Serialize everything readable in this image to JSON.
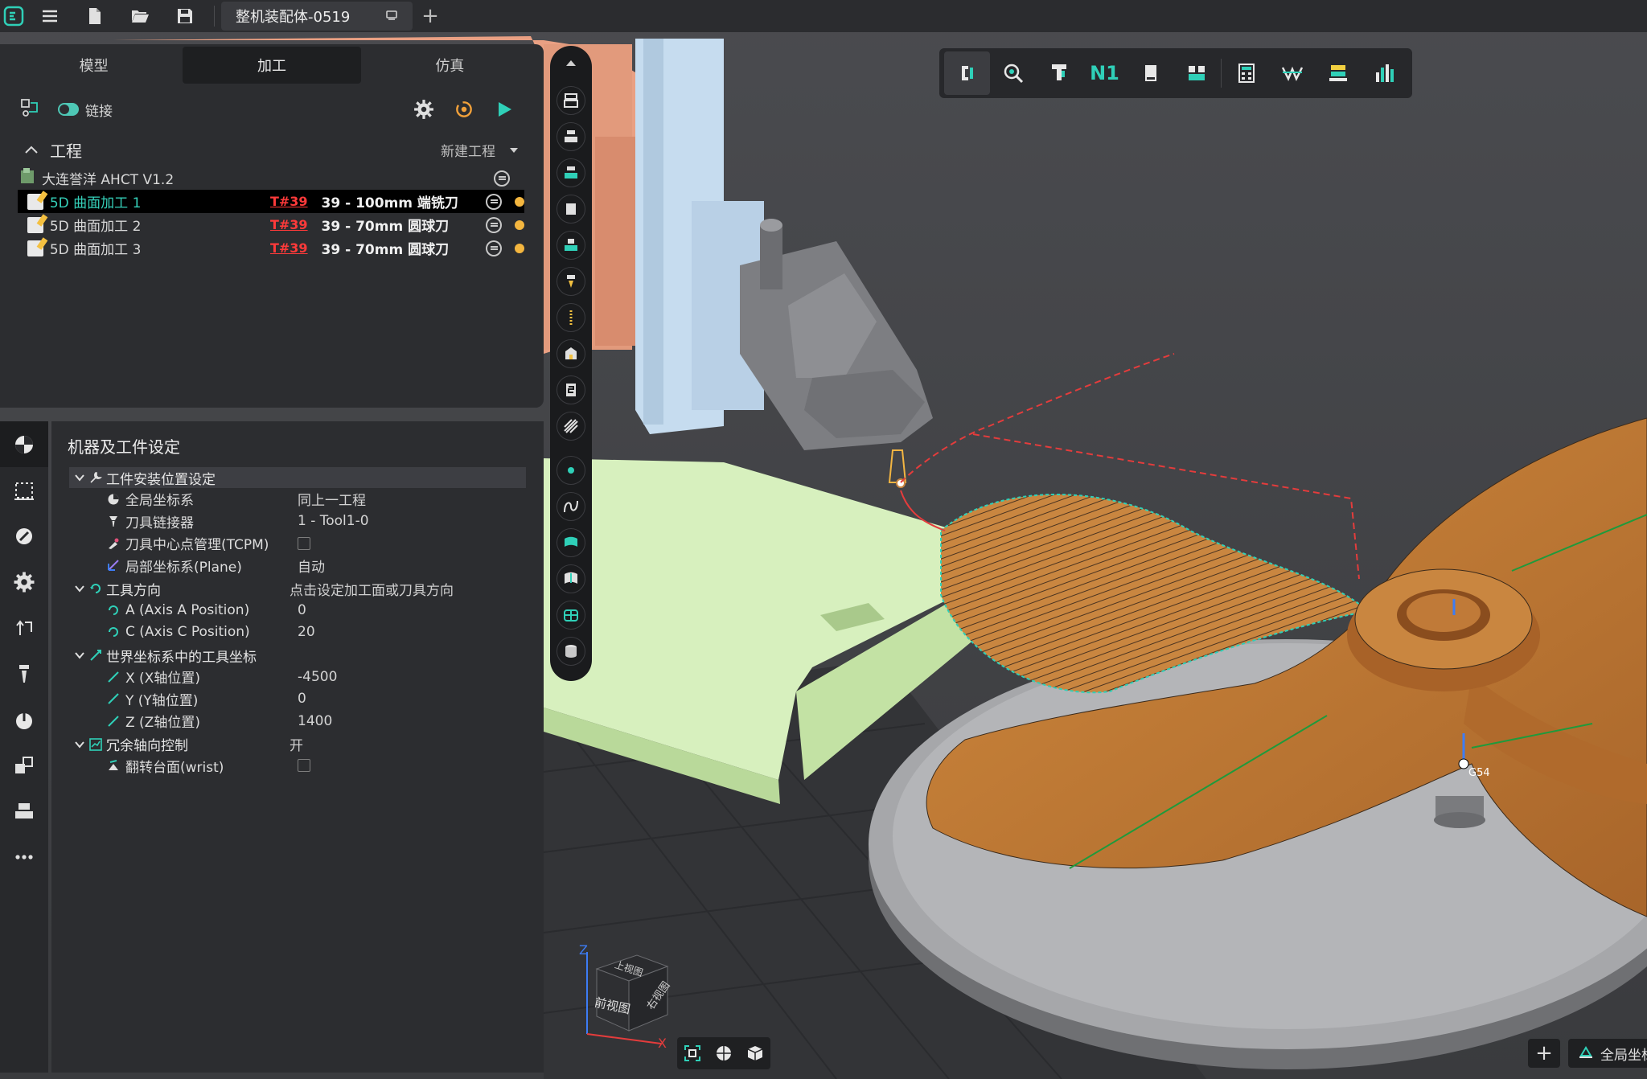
{
  "titlebar": {
    "document_tab": "整机装配体-0519",
    "add_tab": "+"
  },
  "panel_tabs": [
    "模型",
    "加工",
    "仿真"
  ],
  "active_tab": "加工",
  "link": {
    "label": "链接",
    "enabled": true
  },
  "project": {
    "title": "工程",
    "new_project": "新建工程",
    "machine": "大连誉洋 AHCT V1.2",
    "operations": [
      {
        "name": "5D 曲面加工 1",
        "tool_number": "T#39",
        "tool_desc": "39 - 100mm 端铣刀",
        "selected": true
      },
      {
        "name": "5D 曲面加工 2",
        "tool_number": "T#39",
        "tool_desc": "39 - 70mm 圆球刀",
        "selected": false
      },
      {
        "name": "5D 曲面加工 3",
        "tool_number": "T#39",
        "tool_desc": "39 - 70mm 圆球刀",
        "selected": false
      }
    ]
  },
  "settings": {
    "title": "机器及工件设定",
    "groups": [
      {
        "label": "工件安装位置设定",
        "icon": "wrench-icon",
        "rows": [
          {
            "name": "全局坐标系",
            "value": "同上一工程",
            "icon": "globe-icon"
          },
          {
            "name": "刀具链接器",
            "value": "1 - Tool1-0",
            "icon": "tool-holder-icon"
          },
          {
            "name": "刀具中心点管理(TCPM)",
            "value": "",
            "checkbox": true,
            "icon": "tcpm-icon"
          },
          {
            "name": "局部坐标系(Plane)",
            "value": "自动",
            "icon": "plane-axis-icon"
          }
        ]
      },
      {
        "label": "工具方向",
        "icon": "rotate-icon",
        "rows": [
          {
            "name": "A (Axis A Position)",
            "value": "0",
            "icon": "rotate-icon"
          },
          {
            "name": "C (Axis C Position)",
            "value": "20",
            "icon": "rotate-icon"
          }
        ],
        "value": "点击设定加工面或刀具方向"
      },
      {
        "label": "世界坐标系中的工具坐标",
        "icon": "axis-icon",
        "rows": [
          {
            "name": "X (X轴位置)",
            "value": "-4500",
            "icon": "axis-icon"
          },
          {
            "name": "Y (Y轴位置)",
            "value": "0",
            "icon": "axis-icon"
          },
          {
            "name": "Z (Z轴位置)",
            "value": "1400",
            "icon": "axis-icon"
          }
        ]
      },
      {
        "label": "冗余轴向控制",
        "icon": "chart-icon",
        "value": "开",
        "rows": [
          {
            "name": "翻转台面(wrist)",
            "value": "",
            "checkbox": true,
            "icon": "wrist-icon"
          }
        ]
      }
    ]
  },
  "top_toolbar": {
    "n1_label": "N1"
  },
  "viewcube": {
    "top": "上视图",
    "front": "前视图",
    "right": "右视图",
    "z": "Z",
    "x": "X"
  },
  "viewport": {
    "g54_label": "G54"
  },
  "bottom_right": {
    "plus": "+",
    "coord_label": "全局坐标系"
  },
  "colors": {
    "accent": "#35d0b9",
    "propeller": "#c8823c",
    "fixture": "#d9f2c0",
    "warning": "#ff3a3a"
  }
}
